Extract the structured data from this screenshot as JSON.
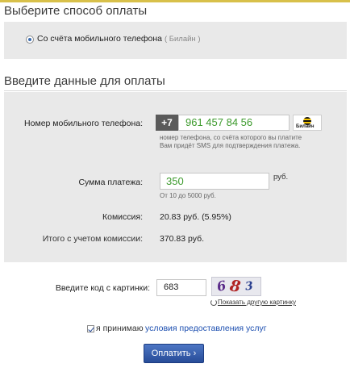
{
  "section_method": {
    "title": "Выберите способ оплаты"
  },
  "payment_method": {
    "label": "Со счёта мобильного телефона",
    "operator": "( Билайн )",
    "selected": true
  },
  "section_data": {
    "title": "Введите данные для оплаты"
  },
  "phone": {
    "label": "Номер мобильного телефона:",
    "prefix": "+7",
    "value": "961 457 84 56",
    "operator_logo_text": "Билайн",
    "hint_line1": "номер телефона, со счёта которого вы платите",
    "hint_line2": "Вам придёт SMS для подтверждения платежа."
  },
  "amount": {
    "label": "Сумма платежа:",
    "value": "350",
    "unit": "руб.",
    "hint": "От 10 до 5000 руб."
  },
  "fee": {
    "label": "Комиссия:",
    "value": "20.83 руб. (5.95%)"
  },
  "total": {
    "label": "Итого с учетом комиссии:",
    "value": "370.83 руб."
  },
  "captcha": {
    "label": "Введите код с картинки:",
    "value": "683",
    "image_text": "683",
    "refresh_label": "Показать другую картинку"
  },
  "agreement": {
    "text": "я принимаю",
    "link": "условия предоставления услуг",
    "checked": true
  },
  "submit": {
    "label": "Оплатить",
    "arrow": "›"
  },
  "colors": {
    "accent_blue": "#274c98",
    "input_green": "#3c9a2c",
    "panel_gray": "#e9e9e9",
    "top_line": "#d8c04a"
  }
}
